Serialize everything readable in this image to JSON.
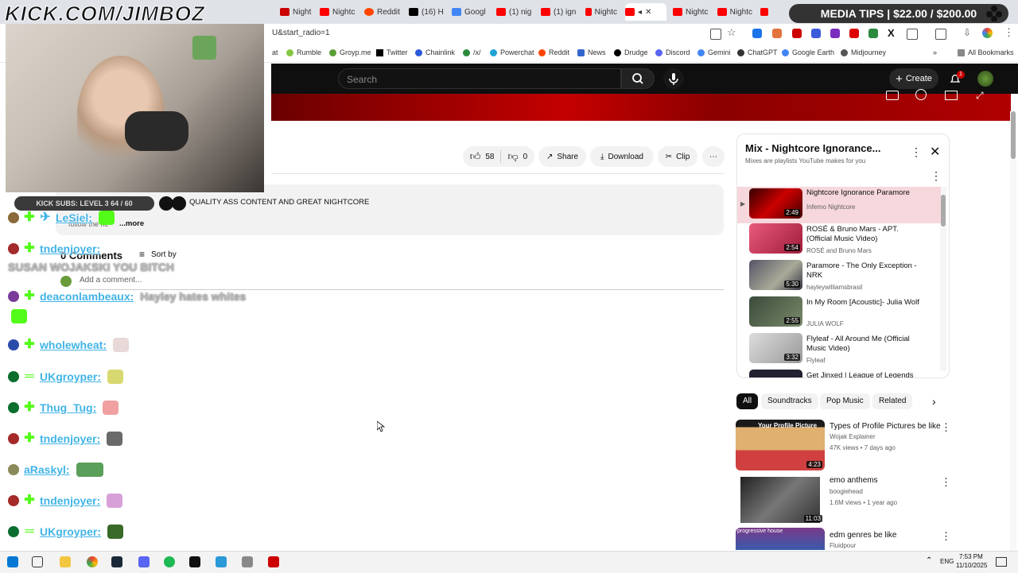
{
  "overlay": {
    "kick_logo": "KICK.COM/JIMBOZ",
    "media_tips": "MEDIA TIPS | $22.00 / $200.00",
    "subs_label": "KICK SUBS: LEVEL 3 64 / 60"
  },
  "tabs": [
    "Night",
    "Nightc",
    "Reddit",
    "(16) H",
    "Googl",
    "(1) nig",
    "(1) ign",
    "Nightc",
    "Nightc",
    "Nightc"
  ],
  "url": {
    "text": "U&start_radio=1"
  },
  "bookmarks": [
    "at",
    "Rumble",
    "Groyp.me",
    "Twitter",
    "Chainlink",
    "/x/",
    "Powerchat",
    "Reddit",
    "News",
    "Drudge",
    "Discord",
    "Gemini",
    "ChatGPT",
    "Google Earth",
    "Midjourney",
    "All Bookmarks"
  ],
  "youtube": {
    "search_placeholder": "Search",
    "create_label": "Create",
    "notif_count": "1",
    "like_count": "58",
    "dislike_count": "0",
    "share_label": "Share",
    "download_label": "Download",
    "clip_label": "Clip",
    "description_text": "QUALITY ASS CONTENT AND GREAT NIGHTCORE",
    "description_follow": "follow the he",
    "more_label": "...more",
    "comments_count": "0 Comments",
    "sort_label": "Sort by",
    "add_comment": "Add a comment..."
  },
  "playlist": {
    "title": "Mix - Nightcore Ignorance...",
    "subtitle": "Mixes are playlists YouTube makes for you",
    "items": [
      {
        "title": "Nightcore Ignorance Paramore",
        "channel": "Inferno Nightcore",
        "duration": "2:49"
      },
      {
        "title": "ROSÉ & Bruno Mars - APT. (Official Music Video)",
        "channel": "ROSÉ and Bruno Mars",
        "duration": "2:54"
      },
      {
        "title": "Paramore - The Only Exception - NRK",
        "channel": "hayleywilliamsbrasil",
        "duration": "5:30"
      },
      {
        "title": "In My Room [Acoustic]- Julia Wolf",
        "channel": "JULIA WOLF",
        "duration": "2:55"
      },
      {
        "title": "Flyleaf - All Around Me (Official Music Video)",
        "channel": "Flyleaf",
        "duration": "3:32"
      },
      {
        "title": "Get Jinxed | League of Legends",
        "channel": "",
        "duration": ""
      }
    ]
  },
  "chips": [
    "All",
    "Soundtracks",
    "Pop Music",
    "Related"
  ],
  "recommendations": [
    {
      "title": "Types of Profile Pictures be like",
      "channel": "Wojak Explainer",
      "meta": "47K views • 7 days ago",
      "duration": "4:23",
      "thumb_text": "Your Profile Picture"
    },
    {
      "title": "emo anthems",
      "channel": "boogiehead",
      "meta": "1.6M views • 1 year ago",
      "duration": "11:03",
      "thumb_text": ""
    },
    {
      "title": "edm genres be like",
      "channel": "Fluidpour",
      "meta": "",
      "duration": "",
      "thumb_text": "progressive house"
    }
  ],
  "chat": [
    {
      "user": "LeSiel:",
      "msg": ""
    },
    {
      "user": "tndenjoyer:",
      "msg": "SUSAN WOJAKSKI YOU BITCH"
    },
    {
      "user": "deaconlambeaux:",
      "msg": "Hayley hates whites"
    },
    {
      "user": "wholewheat:",
      "msg": ""
    },
    {
      "user": "UKgroyper:",
      "msg": ""
    },
    {
      "user": "Thug_Tug:",
      "msg": ""
    },
    {
      "user": "tndenjoyer:",
      "msg": ""
    },
    {
      "user": "aRaskyl:",
      "msg": ""
    },
    {
      "user": "tndenjoyer:",
      "msg": ""
    },
    {
      "user": "UKgroyper:",
      "msg": ""
    }
  ],
  "system_tray": {
    "lang": "ENG",
    "time": "7:53 PM",
    "date": "11/10/2025"
  },
  "colors": {
    "kick_green": "#53fc18",
    "yt_red": "#ff0000",
    "chat_user": "#42b4e6"
  }
}
